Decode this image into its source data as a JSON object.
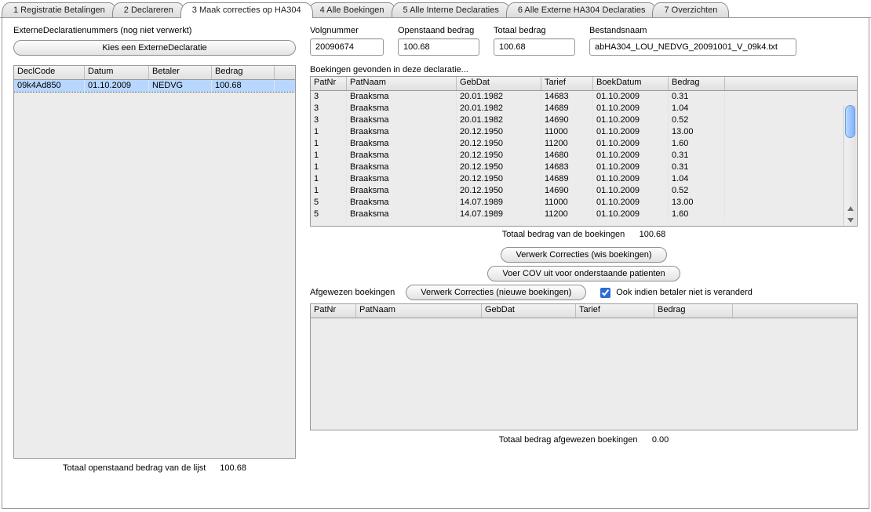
{
  "tabs": [
    "1 Registratie Betalingen",
    "2 Declareren",
    "3 Maak correcties op HA304",
    "4 Alle Boekingen",
    "5 Alle Interne Declaraties",
    "6 Alle Externe HA304 Declaraties",
    "7 Overzichten"
  ],
  "active_tab_index": 2,
  "left_section_label": "ExterneDeclaratienummers (nog niet verwerkt)",
  "choose_button": "Kies een ExterneDeclaratie",
  "fields": {
    "volgnummer": {
      "label": "Volgnummer",
      "value": "20090674"
    },
    "openstaand": {
      "label": "Openstaand bedrag",
      "value": "100.68"
    },
    "totaal": {
      "label": "Totaal bedrag",
      "value": "100.68"
    },
    "bestandsnaam": {
      "label": "Bestandsnaam",
      "value": "abHA304_LOU_NEDVG_20091001_V_09k4.txt"
    }
  },
  "decl_table": {
    "headers": [
      "DeclCode",
      "Datum",
      "Betaler",
      "Bedrag"
    ],
    "rows": [
      {
        "code": "09k4Ad850",
        "datum": "01.10.2009",
        "betaler": "NEDVG",
        "bedrag": "100.68"
      }
    ],
    "footer_label": "Totaal openstaand bedrag van de lijst",
    "footer_value": "100.68"
  },
  "boekingen_caption": "Boekingen gevonden in deze declaratie...",
  "boekingen_table": {
    "headers": [
      "PatNr",
      "PatNaam",
      "GebDat",
      "Tarief",
      "BoekDatum",
      "Bedrag"
    ],
    "rows": [
      {
        "patnr": "3",
        "naam": "Braaksma",
        "gebdat": "20.01.1982",
        "tarief": "14683",
        "boekdat": "01.10.2009",
        "bedrag": "0.31"
      },
      {
        "patnr": "3",
        "naam": "Braaksma",
        "gebdat": "20.01.1982",
        "tarief": "14689",
        "boekdat": "01.10.2009",
        "bedrag": "1.04"
      },
      {
        "patnr": "3",
        "naam": "Braaksma",
        "gebdat": "20.01.1982",
        "tarief": "14690",
        "boekdat": "01.10.2009",
        "bedrag": "0.52"
      },
      {
        "patnr": "1",
        "naam": "Braaksma",
        "gebdat": "20.12.1950",
        "tarief": "11000",
        "boekdat": "01.10.2009",
        "bedrag": "13.00"
      },
      {
        "patnr": "1",
        "naam": "Braaksma",
        "gebdat": "20.12.1950",
        "tarief": "11200",
        "boekdat": "01.10.2009",
        "bedrag": "1.60"
      },
      {
        "patnr": "1",
        "naam": "Braaksma",
        "gebdat": "20.12.1950",
        "tarief": "14680",
        "boekdat": "01.10.2009",
        "bedrag": "0.31"
      },
      {
        "patnr": "1",
        "naam": "Braaksma",
        "gebdat": "20.12.1950",
        "tarief": "14683",
        "boekdat": "01.10.2009",
        "bedrag": "0.31"
      },
      {
        "patnr": "1",
        "naam": "Braaksma",
        "gebdat": "20.12.1950",
        "tarief": "14689",
        "boekdat": "01.10.2009",
        "bedrag": "1.04"
      },
      {
        "patnr": "1",
        "naam": "Braaksma",
        "gebdat": "20.12.1950",
        "tarief": "14690",
        "boekdat": "01.10.2009",
        "bedrag": "0.52"
      },
      {
        "patnr": "5",
        "naam": "Braaksma",
        "gebdat": "14.07.1989",
        "tarief": "11000",
        "boekdat": "01.10.2009",
        "bedrag": "13.00"
      },
      {
        "patnr": "5",
        "naam": "Braaksma",
        "gebdat": "14.07.1989",
        "tarief": "11200",
        "boekdat": "01.10.2009",
        "bedrag": "1.60"
      }
    ],
    "footer_label": "Totaal bedrag van de boekingen",
    "footer_value": "100.68"
  },
  "buttons": {
    "wis": "Verwerk Correcties (wis boekingen)",
    "cov": "Voer COV uit voor onderstaande patienten",
    "nieuw": "Verwerk Correcties (nieuwe boekingen)"
  },
  "afgewezen_caption": "Afgewezen boekingen",
  "checkbox_label": "Ook indien betaler niet is veranderd",
  "checkbox_checked": true,
  "afgewezen_table": {
    "headers": [
      "PatNr",
      "PatNaam",
      "GebDat",
      "Tarief",
      "Bedrag"
    ],
    "footer_label": "Totaal bedrag afgewezen boekingen",
    "footer_value": "0.00"
  }
}
